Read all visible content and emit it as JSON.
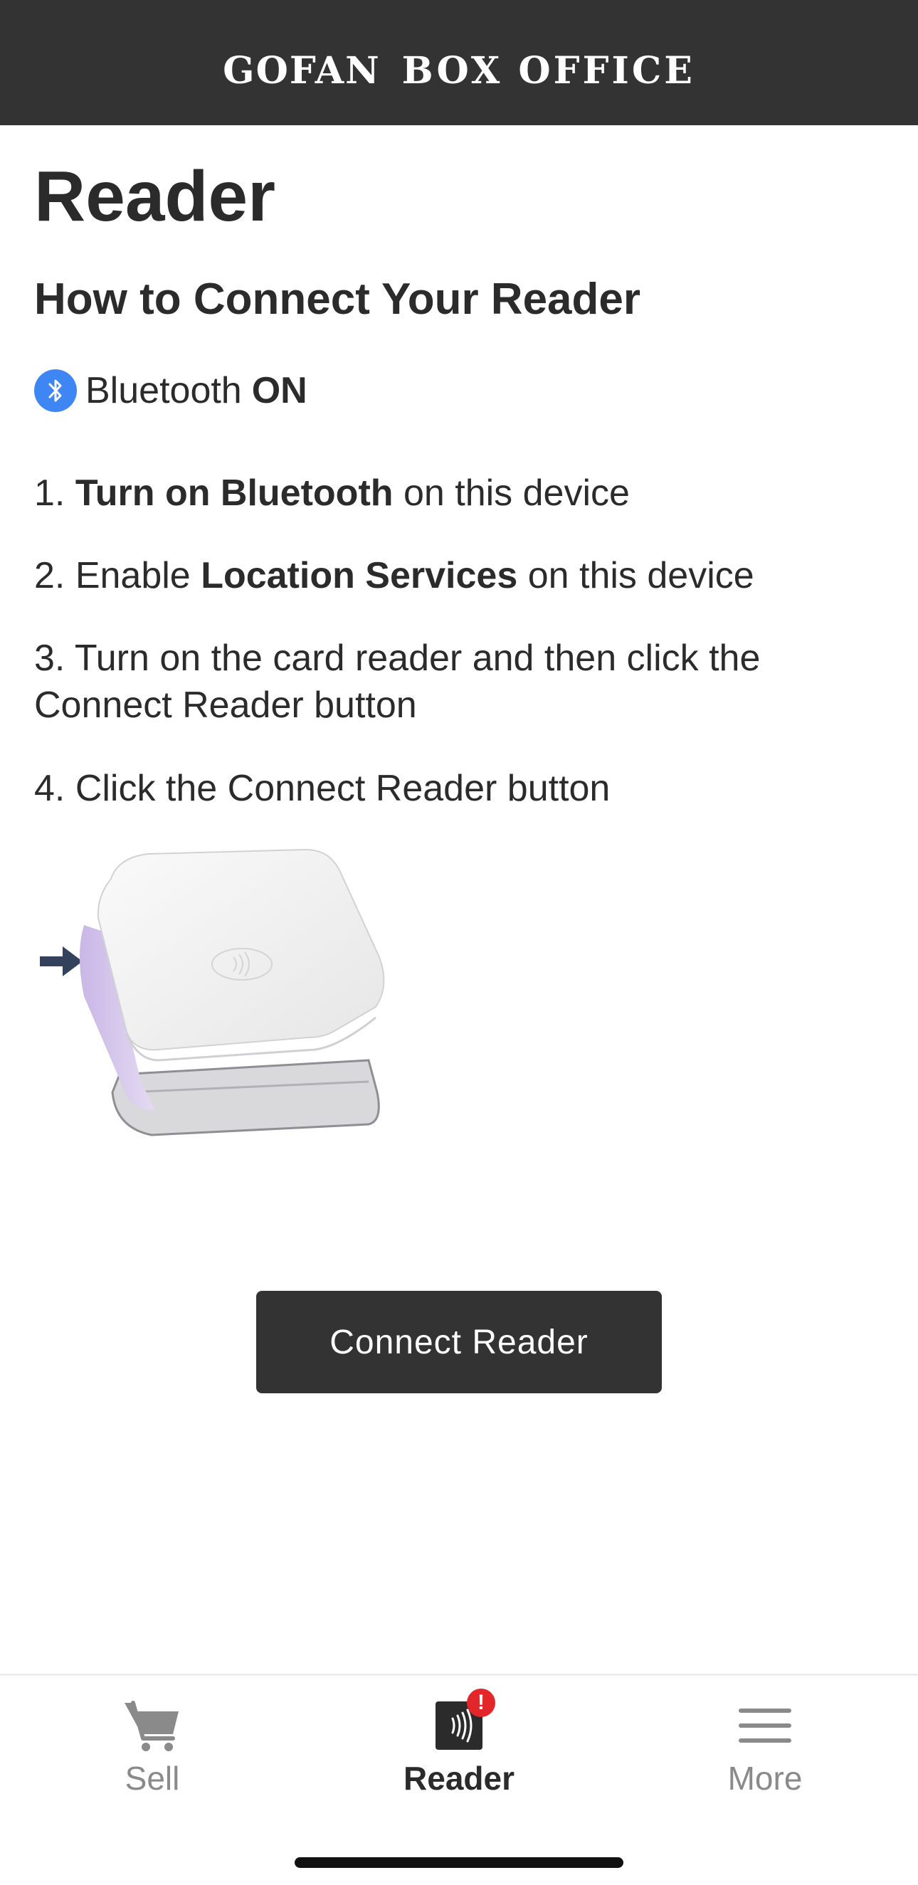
{
  "header": {
    "logo_text_left": "GOFAN",
    "logo_text_right": "BOX OFFICE"
  },
  "page": {
    "title": "Reader",
    "subtitle": "How to Connect Your Reader"
  },
  "bluetooth": {
    "label": "Bluetooth",
    "state": "ON",
    "icon": "bluetooth-icon",
    "icon_color": "#3f86f5"
  },
  "steps": [
    {
      "prefix": "1. ",
      "bold": "Turn on Bluetooth",
      "suffix": " on this device"
    },
    {
      "prefix": "2. Enable ",
      "bold": "Location Services",
      "suffix": " on this device"
    },
    {
      "text": "3. Turn on the card reader and then click the Connect Reader button"
    },
    {
      "text": "4. Click the Connect Reader button"
    }
  ],
  "connect_button": {
    "label": "Connect Reader",
    "color": "#333333"
  },
  "tabs": [
    {
      "label": "Sell",
      "icon": "cart-icon"
    },
    {
      "label": "Reader",
      "icon": "contactless-icon",
      "badge": "!",
      "active": true
    },
    {
      "label": "More",
      "icon": "menu-icon"
    }
  ],
  "colors": {
    "header_bg": "#333333",
    "badge": "#e3262a",
    "active_tab": "#2b2b2b",
    "inactive_tab": "#8a8a8a"
  }
}
